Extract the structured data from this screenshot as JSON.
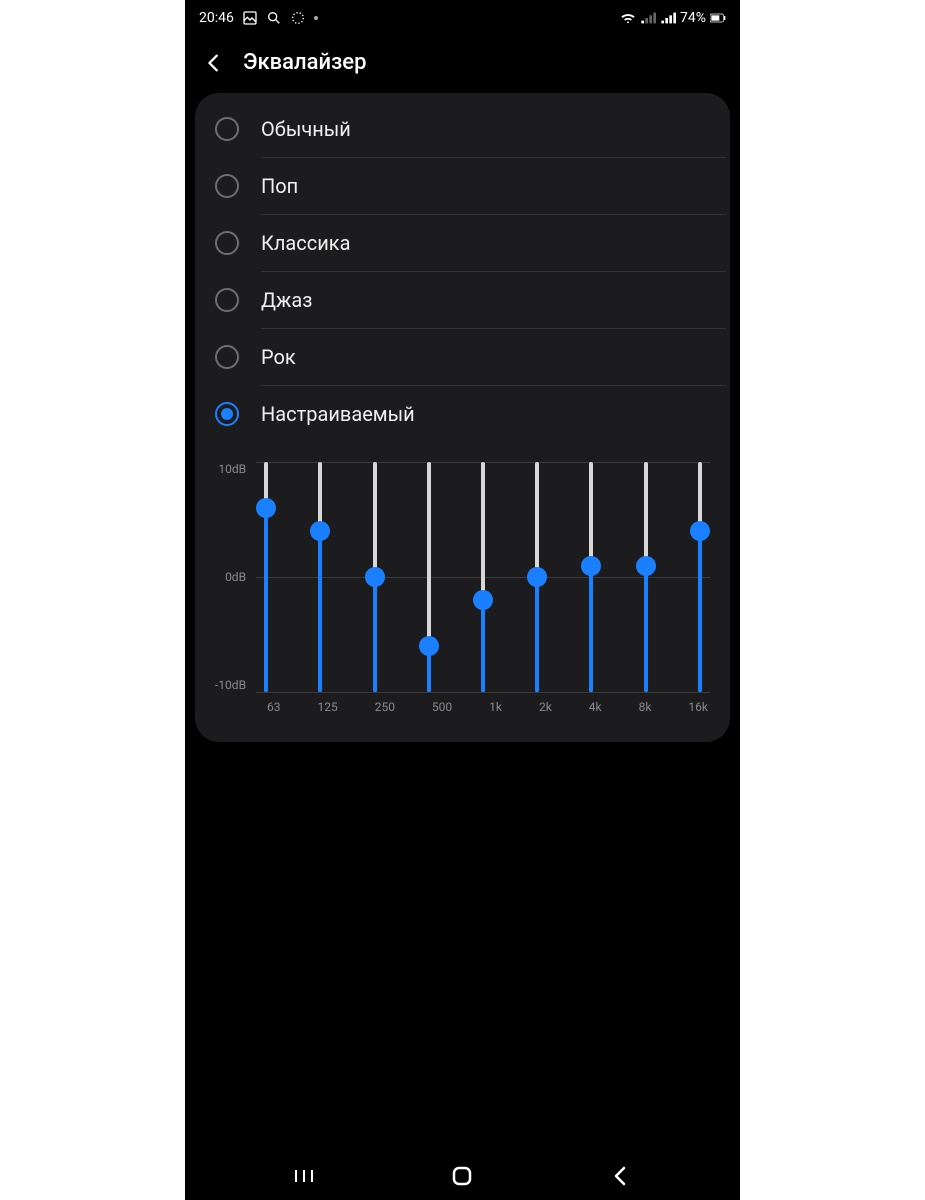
{
  "status": {
    "time": "20:46",
    "battery_text": "74%",
    "icons_left": [
      "gallery-icon",
      "search-icon",
      "loading-icon"
    ],
    "icons_right": [
      "wifi-icon",
      "signal-icon",
      "signal-icon",
      "battery-icon"
    ]
  },
  "header": {
    "title": "Эквалайзер"
  },
  "presets": [
    {
      "id": "normal",
      "label": "Обычный",
      "selected": false
    },
    {
      "id": "pop",
      "label": "Поп",
      "selected": false
    },
    {
      "id": "classic",
      "label": "Классика",
      "selected": false
    },
    {
      "id": "jazz",
      "label": "Джаз",
      "selected": false
    },
    {
      "id": "rock",
      "label": "Рок",
      "selected": false
    },
    {
      "id": "custom",
      "label": "Настраиваемый",
      "selected": true
    }
  ],
  "chart_data": {
    "type": "bar",
    "title": "",
    "ylabel": "dB",
    "ylim": [
      -10,
      10
    ],
    "y_ticks": [
      "10dB",
      "0dB",
      "-10dB"
    ],
    "categories": [
      "63",
      "125",
      "250",
      "500",
      "1k",
      "2k",
      "4k",
      "8k",
      "16k"
    ],
    "values": [
      6,
      4,
      0,
      -6,
      -2,
      0,
      1,
      1,
      4
    ]
  },
  "colors": {
    "accent": "#1a80ff",
    "card": "#1c1c1e",
    "track": "#d8d8d8",
    "muted": "#8a8a8a"
  }
}
